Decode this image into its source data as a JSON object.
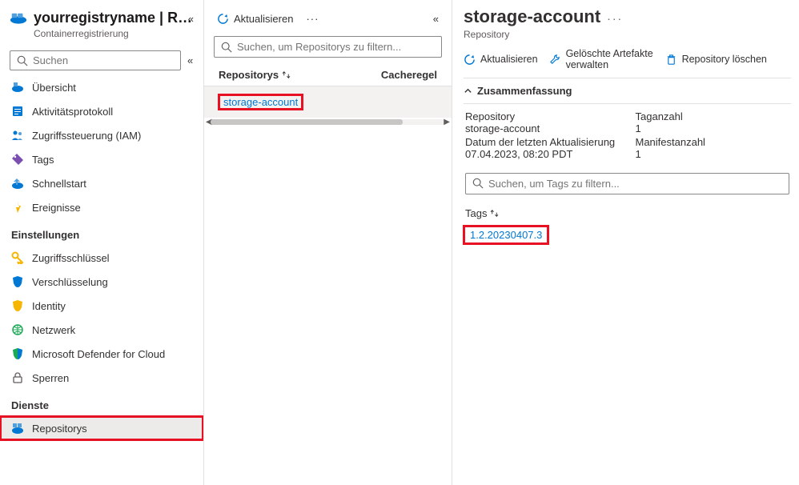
{
  "header": {
    "title": "yourregistryname | Repositorys",
    "subtitle": "Containerregistrierung"
  },
  "sidebar": {
    "search_placeholder": "Suchen",
    "items_top": [
      {
        "label": "Übersicht",
        "icon": "overview"
      },
      {
        "label": "Aktivitätsprotokoll",
        "icon": "log"
      },
      {
        "label": "Zugriffssteuerung (IAM)",
        "icon": "iam"
      },
      {
        "label": "Tags",
        "icon": "tag"
      },
      {
        "label": "Schnellstart",
        "icon": "quickstart"
      },
      {
        "label": "Ereignisse",
        "icon": "events"
      }
    ],
    "group_settings": "Einstellungen",
    "items_settings": [
      {
        "label": "Zugriffsschlüssel",
        "icon": "key"
      },
      {
        "label": "Verschlüsselung",
        "icon": "shield"
      },
      {
        "label": "Identity",
        "icon": "shield2"
      },
      {
        "label": "Netzwerk",
        "icon": "network"
      },
      {
        "label": "Microsoft Defender for Cloud",
        "icon": "defender"
      },
      {
        "label": "Sperren",
        "icon": "lock"
      }
    ],
    "group_services": "Dienste",
    "items_services": [
      {
        "label": "Repositorys",
        "icon": "repo",
        "active": true
      }
    ]
  },
  "middle": {
    "refresh": "Aktualisieren",
    "search_placeholder": "Suchen, um Repositorys zu filtern...",
    "col1": "Repositorys",
    "col2": "Cacheregel",
    "rows": [
      {
        "name": "storage-account"
      }
    ]
  },
  "right": {
    "title": "storage-account",
    "subtitle": "Repository",
    "toolbar": {
      "refresh": "Aktualisieren",
      "manage_deleted": "Gelöschte Artefakte verwalten",
      "delete_repo": "Repository löschen"
    },
    "summary_label": "Zusammenfassung",
    "meta": {
      "repo_lbl": "Repository",
      "repo_val": "storage-account",
      "tagcount_lbl": "Taganzahl",
      "tagcount_val": "1",
      "date_lbl": "Datum der letzten Aktualisierung",
      "date_val": "07.04.2023, 08:20 PDT",
      "manifest_lbl": "Manifestanzahl",
      "manifest_val": "1"
    },
    "search_placeholder": "Suchen, um Tags zu filtern...",
    "tags_header": "Tags",
    "tags": [
      "1.2.20230407.3"
    ]
  }
}
